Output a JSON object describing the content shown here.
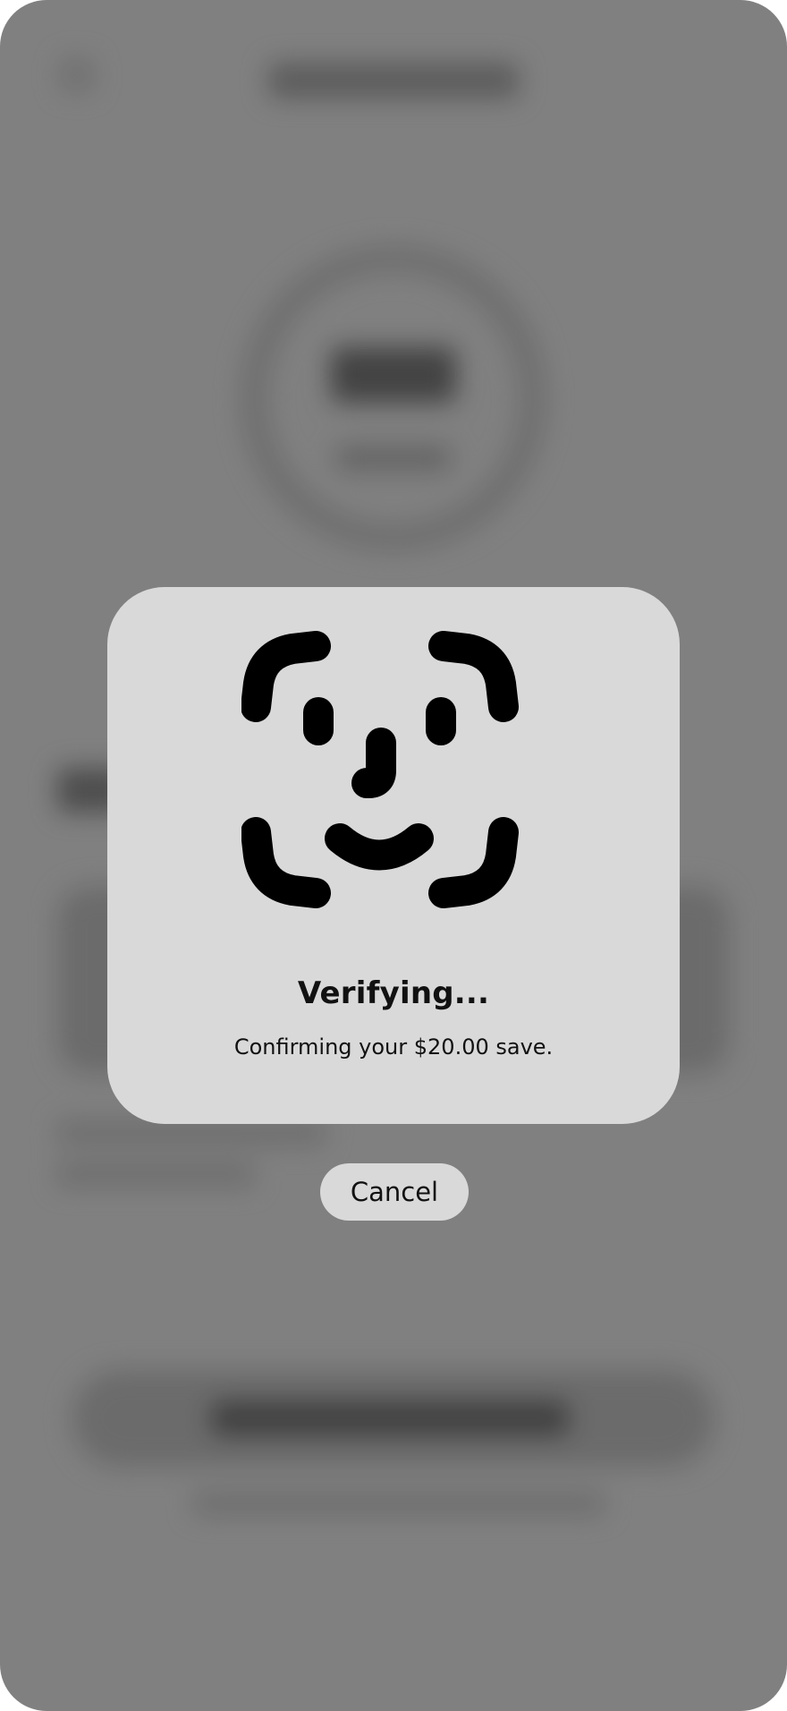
{
  "verification": {
    "title": "Verifying...",
    "subtitle": "Confirming your $20.00 save.",
    "icon": "face-id-icon",
    "cancel_label": "Cancel"
  },
  "colors": {
    "background": "#808080",
    "card": "#d9d9d9",
    "text": "#111111",
    "icon": "#000000"
  }
}
